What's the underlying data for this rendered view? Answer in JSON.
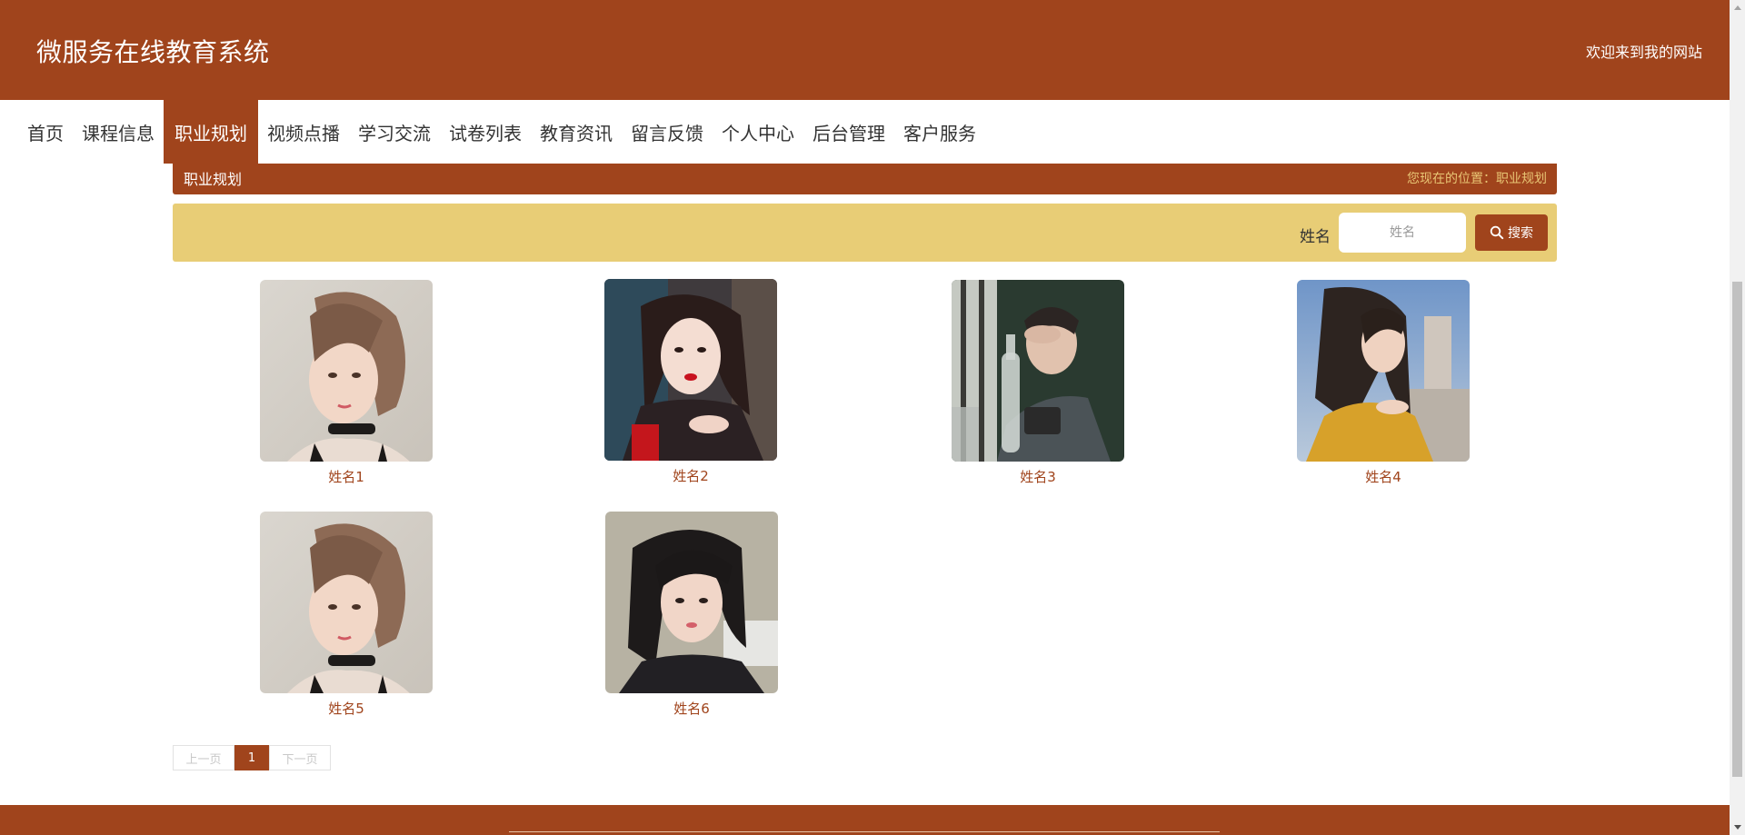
{
  "header": {
    "site_title": "微服务在线教育系统",
    "welcome": "欢迎来到我的网站"
  },
  "nav": {
    "items": [
      {
        "label": "首页"
      },
      {
        "label": "课程信息"
      },
      {
        "label": "职业规划",
        "active": true
      },
      {
        "label": "视频点播"
      },
      {
        "label": "学习交流"
      },
      {
        "label": "试卷列表"
      },
      {
        "label": "教育资讯"
      },
      {
        "label": "留言反馈"
      },
      {
        "label": "个人中心"
      },
      {
        "label": "后台管理"
      },
      {
        "label": "客户服务"
      }
    ]
  },
  "breadcrumb": {
    "title": "职业规划",
    "path": "您现在的位置：职业规划"
  },
  "search": {
    "label": "姓名",
    "placeholder": "姓名",
    "value": "",
    "button_label": "搜索"
  },
  "cards": [
    {
      "name": "姓名1",
      "photo": "portrait-woman-choker"
    },
    {
      "name": "姓名2",
      "photo": "portrait-woman-red-lips"
    },
    {
      "name": "姓名3",
      "photo": "portrait-man-bottle"
    },
    {
      "name": "姓名4",
      "photo": "portrait-woman-sunlight"
    },
    {
      "name": "姓名5",
      "photo": "portrait-woman-choker"
    },
    {
      "name": "姓名6",
      "photo": "portrait-woman-dark-hair"
    }
  ],
  "pagination": {
    "prev_label": "上一页",
    "current_page": "1",
    "next_label": "下一页"
  },
  "colors": {
    "brand": "#a0441c",
    "search_bar": "#e8cd76",
    "crumb_path": "#e8c574"
  }
}
